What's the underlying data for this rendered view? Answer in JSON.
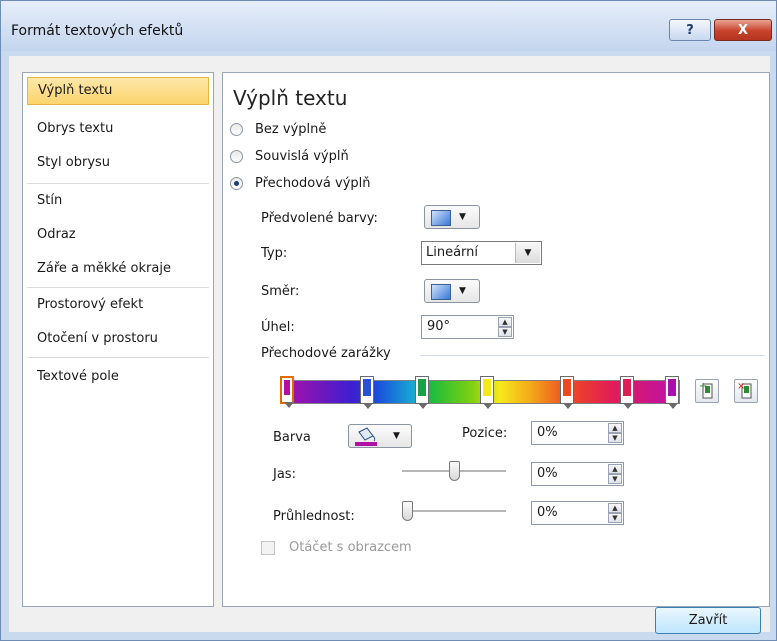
{
  "window": {
    "title": "Formát textových efektů",
    "help_glyph": "?",
    "close_glyph": "X"
  },
  "nav": {
    "items": [
      {
        "label": "Výplň textu"
      },
      {
        "label": "Obrys textu"
      },
      {
        "label": "Styl obrysu"
      },
      {
        "label": "Stín"
      },
      {
        "label": "Odraz"
      },
      {
        "label": "Záře a měkké okraje"
      },
      {
        "label": "Prostorový efekt"
      },
      {
        "label": "Otočení v prostoru"
      },
      {
        "label": "Textové pole"
      }
    ],
    "selected_index": 0
  },
  "panel": {
    "title": "Výplň textu",
    "fill_options": [
      {
        "label": "Bez výplně",
        "selected": false
      },
      {
        "label": "Souvislá výplň",
        "selected": false
      },
      {
        "label": "Přechodová výplň",
        "selected": true
      }
    ],
    "preset_colors_label": "Předvolené barvy:",
    "type_label": "Typ:",
    "type_value": "Lineární",
    "direction_label": "Směr:",
    "angle_label": "Úhel:",
    "angle_value": "90°",
    "gradient_stops_label": "Přechodové zarážky",
    "gradient_stops": [
      {
        "color": "#b10fa6",
        "selected": true
      },
      {
        "color": "#2a4fd7",
        "selected": false
      },
      {
        "color": "#1aa048",
        "selected": false
      },
      {
        "color": "#f6e91a",
        "selected": false
      },
      {
        "color": "#ee4a1f",
        "selected": false
      },
      {
        "color": "#e21d56",
        "selected": false
      },
      {
        "color": "#a90faa",
        "selected": false
      }
    ],
    "color_label": "Barva",
    "position_label": "Pozice:",
    "position_value": "0%",
    "brightness_label": "Jas:",
    "brightness_value": "0%",
    "brightness_level": 0.5,
    "transparency_label": "Průhlednost:",
    "transparency_value": "0%",
    "transparency_level": 0,
    "rotate_label": "Otáčet s obrazcem",
    "rotate_checked": false
  },
  "footer": {
    "close_label": "Zavřít"
  }
}
